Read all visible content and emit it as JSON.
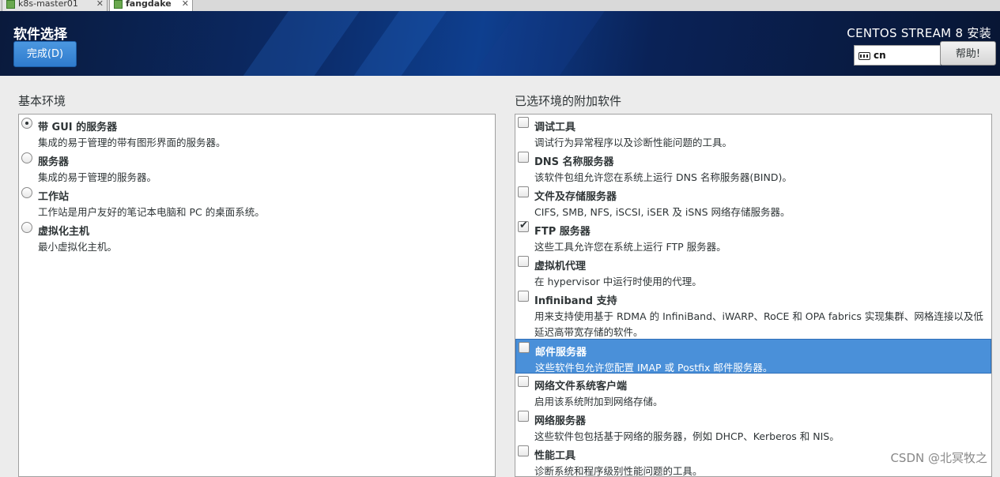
{
  "vm_tabs": [
    {
      "label": "k8s-master01",
      "active": false
    },
    {
      "label": "fangdake",
      "active": true
    }
  ],
  "header": {
    "page_title": "软件选择",
    "done_button": "完成(D)",
    "product_title": "CENTOS STREAM 8 安装",
    "keyboard_layout": "cn",
    "help_button": "帮助!"
  },
  "base_env": {
    "heading": "基本环境",
    "items": [
      {
        "title": "带 GUI 的服务器",
        "desc": "集成的易于管理的带有图形界面的服务器。",
        "selected": true
      },
      {
        "title": "服务器",
        "desc": "集成的易于管理的服务器。",
        "selected": false
      },
      {
        "title": "工作站",
        "desc": "工作站是用户友好的笔记本电脑和 PC 的桌面系统。",
        "selected": false
      },
      {
        "title": "虚拟化主机",
        "desc": "最小虚拟化主机。",
        "selected": false
      }
    ]
  },
  "addons": {
    "heading": "已选环境的附加软件",
    "items": [
      {
        "title": "调试工具",
        "desc": "调试行为异常程序以及诊断性能问题的工具。",
        "checked": false
      },
      {
        "title": "DNS 名称服务器",
        "desc": "该软件包组允许您在系统上运行 DNS 名称服务器(BIND)。",
        "checked": false
      },
      {
        "title": "文件及存储服务器",
        "desc": "CIFS, SMB, NFS, iSCSI, iSER 及 iSNS 网络存储服务器。",
        "checked": false
      },
      {
        "title": "FTP 服务器",
        "desc": "这些工具允许您在系统上运行 FTP 服务器。",
        "checked": true
      },
      {
        "title": "虚拟机代理",
        "desc": "在 hypervisor 中运行时使用的代理。",
        "checked": false
      },
      {
        "title": "Infiniband 支持",
        "desc": "用来支持使用基于 RDMA 的 InfiniBand、iWARP、RoCE 和 OPA fabrics 实现集群、网格连接以及低延迟高带宽存储的软件。",
        "checked": false
      },
      {
        "title": "邮件服务器",
        "desc": "这些软件包允许您配置 IMAP 或 Postfix 邮件服务器。",
        "checked": false
      },
      {
        "title": "网络文件系统客户端",
        "desc": "启用该系统附加到网络存储。",
        "checked": false
      },
      {
        "title": "网络服务器",
        "desc": "这些软件包包括基于网络的服务器，例如 DHCP、Kerberos 和 NIS。",
        "checked": false
      },
      {
        "title": "性能工具",
        "desc": "诊断系统和程序级别性能问题的工具。",
        "checked": false
      }
    ]
  },
  "watermark": "CSDN @北冥牧之"
}
